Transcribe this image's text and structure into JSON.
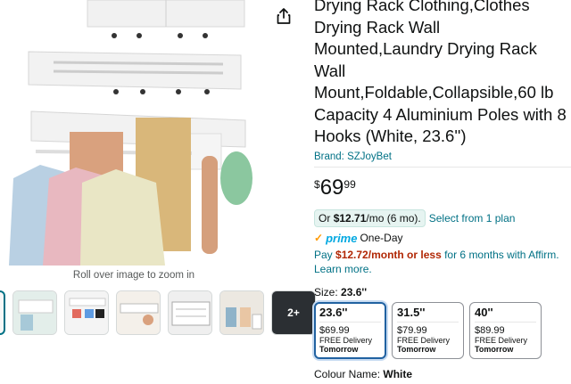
{
  "product": {
    "title": "Drying Rack Clothing,Clothes Drying Rack Wall Mounted,Laundry Drying Rack Wall Mount,Foldable,Collapsible,60 lb Capacity 4 Aluminium Poles with 8 Hooks (White, 23.6'')",
    "brand": "Brand: SZJoyBet"
  },
  "price": {
    "currency": "$",
    "whole": "69",
    "fraction": "99"
  },
  "monthly": {
    "or_label": "Or",
    "amount": "$12.71",
    "term": "/mo (6 mo).",
    "plan_link": "Select from 1 plan"
  },
  "prime": {
    "check": "✓",
    "word": "prime",
    "delivery": "One-Day"
  },
  "affirm": {
    "pay": "Pay",
    "amount": "$12.72/month or less",
    "rest": "for 6 months with Affirm.",
    "learn_more": "Learn more."
  },
  "image": {
    "zoom_hint": "Roll over image to zoom in",
    "more_count": "2+"
  },
  "size": {
    "label": "Size:",
    "selected": "23.6''",
    "options": [
      {
        "size": "23.6''",
        "price": "$69.99",
        "delivery": "FREE Delivery",
        "day": "Tomorrow"
      },
      {
        "size": "31.5''",
        "price": "$79.99",
        "delivery": "FREE Delivery",
        "day": "Tomorrow"
      },
      {
        "size": "40''",
        "price": "$89.99",
        "delivery": "FREE Delivery",
        "day": "Tomorrow"
      }
    ]
  },
  "color": {
    "label": "Colour Name:",
    "value": "White"
  },
  "colors": {
    "link": "#007185",
    "price_red": "#b12704",
    "prime_blue": "#00a8e1",
    "selected_border": "#2162a1"
  }
}
